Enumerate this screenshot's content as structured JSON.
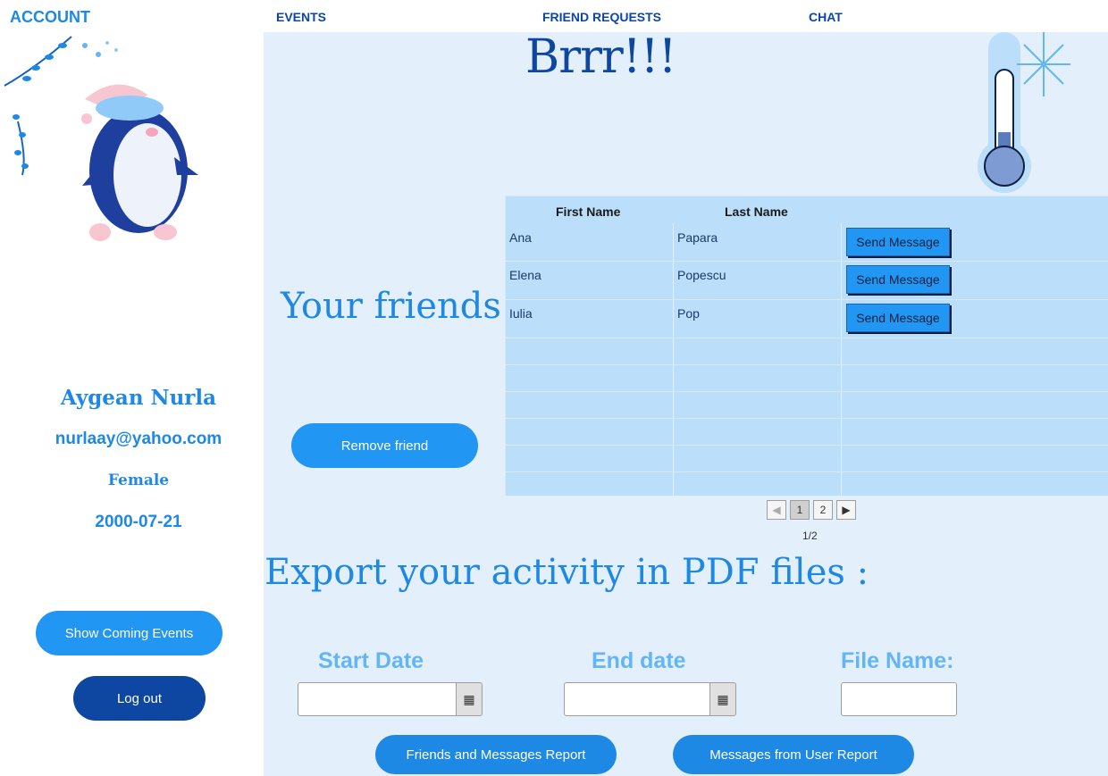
{
  "nav": {
    "account": "ACCOUNT",
    "events": "EVENTS",
    "friend_requests": "FRIEND REQUESTS",
    "chat": "CHAT"
  },
  "header": {
    "title": "Brrr!!!"
  },
  "profile": {
    "name": "Aygean Nurla",
    "email": "nurlaay@yahoo.com",
    "gender": "Female",
    "birthdate": "2000-07-21"
  },
  "sidebar": {
    "show_events": "Show Coming Events",
    "logout": "Log out"
  },
  "friends": {
    "title": "Your friends",
    "remove_button": "Remove friend",
    "columns": [
      "First Name",
      "Last Name"
    ],
    "rows": [
      {
        "first": "Ana",
        "last": "Papara",
        "action": "Send Message"
      },
      {
        "first": "Elena",
        "last": "Popescu",
        "action": "Send Message"
      },
      {
        "first": "Iulia",
        "last": "Pop",
        "action": "Send Message"
      }
    ],
    "pagination": {
      "pages": [
        "1",
        "2"
      ],
      "current": "1",
      "info": "1/2"
    }
  },
  "export": {
    "title": "Export your activity in PDF files :",
    "start_label": "Start Date",
    "end_label": "End date",
    "file_label": "File Name:",
    "start_value": "",
    "end_value": "",
    "file_value": "",
    "report1": "Friends and Messages Report",
    "report2": "Messages from User Report"
  },
  "colors": {
    "primary": "#2196f3",
    "dark": "#0d47a1",
    "panel": "#e3f0fb",
    "table": "#bbdefb"
  }
}
